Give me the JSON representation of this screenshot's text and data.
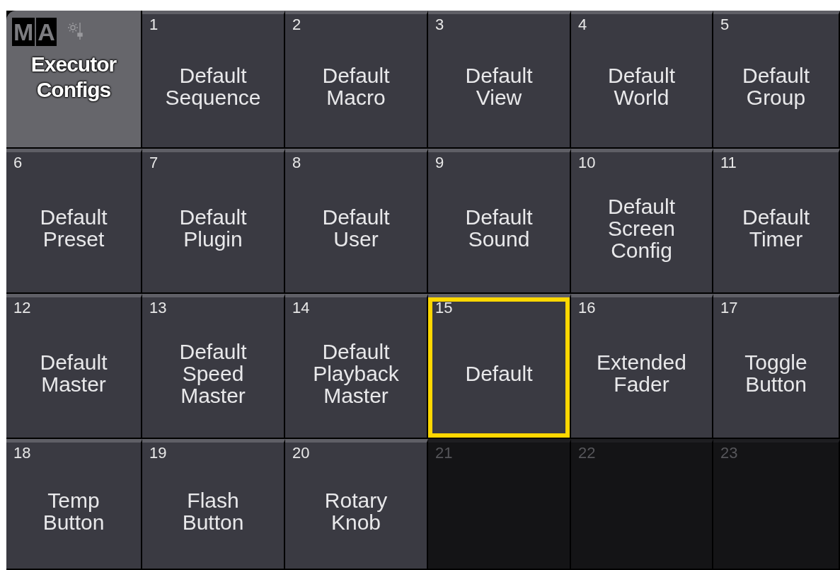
{
  "header": {
    "logo_letters": [
      "M",
      "A"
    ],
    "title_lines": [
      "Executor",
      "Configs"
    ]
  },
  "tiles": [
    {
      "kind": "executor",
      "number": "1",
      "lines": [
        "Default",
        "Sequence"
      ],
      "selected": false
    },
    {
      "kind": "executor",
      "number": "2",
      "lines": [
        "Default",
        "Macro"
      ],
      "selected": false
    },
    {
      "kind": "executor",
      "number": "3",
      "lines": [
        "Default",
        "View"
      ],
      "selected": false
    },
    {
      "kind": "executor",
      "number": "4",
      "lines": [
        "Default",
        "World"
      ],
      "selected": false
    },
    {
      "kind": "executor",
      "number": "5",
      "lines": [
        "Default",
        "Group"
      ],
      "selected": false
    },
    {
      "kind": "executor",
      "number": "6",
      "lines": [
        "Default",
        "Preset"
      ],
      "selected": false
    },
    {
      "kind": "executor",
      "number": "7",
      "lines": [
        "Default",
        "Plugin"
      ],
      "selected": false
    },
    {
      "kind": "executor",
      "number": "8",
      "lines": [
        "Default",
        "User"
      ],
      "selected": false
    },
    {
      "kind": "executor",
      "number": "9",
      "lines": [
        "Default",
        "Sound"
      ],
      "selected": false
    },
    {
      "kind": "executor",
      "number": "10",
      "lines": [
        "Default",
        "Screen",
        "Config"
      ],
      "selected": false
    },
    {
      "kind": "executor",
      "number": "11",
      "lines": [
        "Default",
        "Timer"
      ],
      "selected": false
    },
    {
      "kind": "executor",
      "number": "12",
      "lines": [
        "Default",
        "Master"
      ],
      "selected": false
    },
    {
      "kind": "executor",
      "number": "13",
      "lines": [
        "Default",
        "Speed",
        "Master"
      ],
      "selected": false
    },
    {
      "kind": "executor",
      "number": "14",
      "lines": [
        "Default",
        "Playback",
        "Master"
      ],
      "selected": false
    },
    {
      "kind": "executor",
      "number": "15",
      "lines": [
        "Default"
      ],
      "selected": true
    },
    {
      "kind": "executor",
      "number": "16",
      "lines": [
        "Extended",
        "Fader"
      ],
      "selected": false
    },
    {
      "kind": "executor",
      "number": "17",
      "lines": [
        "Toggle",
        "Button"
      ],
      "selected": false
    },
    {
      "kind": "executor",
      "number": "18",
      "lines": [
        "Temp",
        "Button"
      ],
      "selected": false
    },
    {
      "kind": "executor",
      "number": "19",
      "lines": [
        "Flash",
        "Button"
      ],
      "selected": false
    },
    {
      "kind": "executor",
      "number": "20",
      "lines": [
        "Rotary",
        "Knob"
      ],
      "selected": false
    },
    {
      "kind": "empty",
      "number": "21",
      "selected": false
    },
    {
      "kind": "empty",
      "number": "22",
      "selected": false
    },
    {
      "kind": "empty",
      "number": "23",
      "selected": false
    }
  ]
}
